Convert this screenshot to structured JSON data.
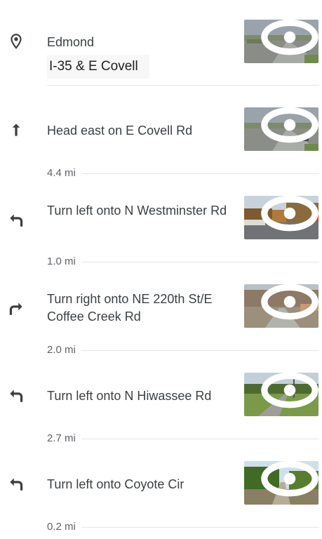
{
  "start": {
    "place": "Edmond",
    "address": "I-35 & E Covell",
    "icon": "location-pin-icon"
  },
  "steps": [
    {
      "icon": "straight-arrow-icon",
      "instruction": "Head east on E Covell Rd",
      "distance": "4.4 mi"
    },
    {
      "icon": "turn-left-icon",
      "instruction": "Turn left onto N Westminster Rd",
      "distance": "1.0 mi"
    },
    {
      "icon": "turn-right-icon",
      "instruction": "Turn right onto NE 220th St/E Coffee Creek Rd",
      "distance": "2.0 mi"
    },
    {
      "icon": "turn-left-icon",
      "instruction": "Turn left onto N Hiwassee Rd",
      "distance": "2.7 mi"
    },
    {
      "icon": "turn-left-icon",
      "instruction": "Turn left onto Coyote Cir",
      "distance": "0.2 mi"
    }
  ],
  "colors": {
    "text": "#3c4043",
    "distance": "#5f6368",
    "divider": "#e6e6e6"
  }
}
